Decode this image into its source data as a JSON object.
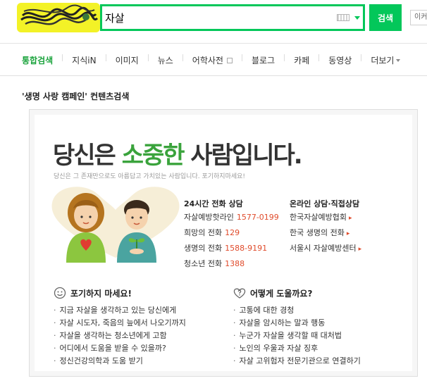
{
  "header": {
    "search_query": "자살",
    "search_button_label": "검색",
    "extra_button_label": "이커"
  },
  "nav": {
    "tabs": [
      "통합검색",
      "지식iN",
      "이미지",
      "뉴스",
      "어학사전",
      "블로그",
      "카페",
      "동영상",
      "더보기"
    ],
    "active_index": 0
  },
  "section_title": "'생명 사랑 캠페인' 컨텐츠검색",
  "campaign": {
    "headline_prefix": "당신은 ",
    "headline_highlight": "소중한",
    "headline_suffix": " 사람입니다.",
    "subheadline": "당신은 그 존재만으로도 아름답고 가치있는 사람입니다. 포기하지마세요!",
    "phone_column": {
      "title": "24시간 전화 상담",
      "items": [
        {
          "name": "자살예방핫라인",
          "number": "1577-0199"
        },
        {
          "name": "희망의 전화",
          "number": "129"
        },
        {
          "name": "생명의 전화",
          "number": "1588-9191"
        },
        {
          "name": "청소년 전화",
          "number": "1388"
        }
      ]
    },
    "online_column": {
      "title": "온라인 상담·직접상담",
      "items": [
        "한국자살예방협회",
        "한국 생명의 전화",
        "서울시 자살예방센터"
      ]
    },
    "tips_left": {
      "title": "포기하지 마세요!",
      "items": [
        "지금 자살을 생각하고 있는 당신에게",
        "자살 시도자, 죽음의 늪에서 나오기까지",
        "자살을 생각하는 청소년에게 고함",
        "어디에서 도움을 받을 수 있을까?",
        "정신건강의학과 도움 받기"
      ]
    },
    "tips_right": {
      "title": "어떻게 도울까요?",
      "items": [
        "고통에 대한 경청",
        "자살을 암시하는 말과 행동",
        "누군가 자살을 생각할 때 대처법",
        "노인의 우울과 자살 징후",
        "자살 고위험자 전문기관으로 연결하기"
      ]
    }
  },
  "colors": {
    "brand_green": "#03c75a",
    "headline_green": "#3aa33c",
    "highlight_red": "#e04b2b",
    "logo_yellow": "#f3f227"
  }
}
